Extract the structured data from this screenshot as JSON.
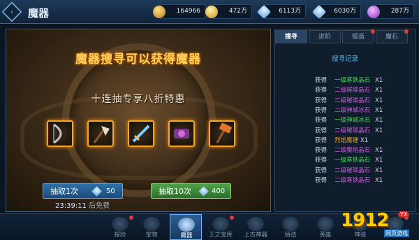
{
  "header": {
    "back_icon_label": "‹",
    "title": "魔器"
  },
  "resources": [
    {
      "icon": "coin-icon",
      "value": "164966"
    },
    {
      "icon": "gold-icon",
      "value": "472万"
    },
    {
      "icon": "crystal-icon",
      "value": "6113万"
    },
    {
      "icon": "crystal-icon",
      "value": "6030万"
    },
    {
      "icon": "gem-icon",
      "value": "287万"
    }
  ],
  "main": {
    "headline": "魔器搜寻可以获得魔器",
    "subline": "十连抽专享八折特惠",
    "draw_one": {
      "label": "抽取1次",
      "cost": "50"
    },
    "draw_ten": {
      "label": "抽取10次",
      "cost": "400"
    },
    "timer": "23:39:11",
    "timer_suffix": "后免费"
  },
  "tabs": [
    {
      "label": "搜寻",
      "active": true
    },
    {
      "label": "进阶",
      "active": false
    },
    {
      "label": "锻造",
      "active": false
    },
    {
      "label": "魔石",
      "active": false
    }
  ],
  "records": {
    "title": "搜寻记录",
    "items": [
      {
        "verb": "获得",
        "name": "一级寒铁晶石",
        "qty": "X1",
        "color": "green"
      },
      {
        "verb": "获得",
        "name": "二级璀璨晶石",
        "qty": "X1",
        "color": "purple"
      },
      {
        "verb": "获得",
        "name": "二级璀璨晶石",
        "qty": "X1",
        "color": "purple"
      },
      {
        "verb": "获得",
        "name": "二级神城冰石",
        "qty": "X1",
        "color": "purple"
      },
      {
        "verb": "获得",
        "name": "一级神城冰石",
        "qty": "X1",
        "color": "green"
      },
      {
        "verb": "获得",
        "name": "二级璀璨晶石",
        "qty": "X1",
        "color": "purple"
      },
      {
        "verb": "获得",
        "name": "烈焰魔锤",
        "qty": "X1",
        "color": "orange"
      },
      {
        "verb": "获得",
        "name": "二级魔焰晶石",
        "qty": "X1",
        "color": "purple"
      },
      {
        "verb": "获得",
        "name": "一级寒铁晶石",
        "qty": "X1",
        "color": "green"
      },
      {
        "verb": "获得",
        "name": "二级璀璨晶石",
        "qty": "X1",
        "color": "purple"
      },
      {
        "verb": "获得",
        "name": "二级寒铁晶石",
        "qty": "X1",
        "color": "purple"
      }
    ]
  },
  "nav": [
    {
      "label": "探险",
      "icon": "explore-icon",
      "dot": true
    },
    {
      "label": "宝物",
      "icon": "treasure-icon",
      "dot": false
    },
    {
      "label": "魔器",
      "icon": "magic-weapon-icon",
      "dot": false,
      "active": true
    },
    {
      "label": "王之宝库",
      "icon": "vault-icon",
      "dot": true
    },
    {
      "label": "上古神器",
      "icon": "artifact-icon",
      "dot": false
    },
    {
      "label": "铸造",
      "icon": "forge-icon",
      "dot": false
    },
    {
      "label": "英雄",
      "icon": "hero-icon",
      "dot": false
    },
    {
      "label": "神装",
      "icon": "divine-gear-icon",
      "dot": false
    },
    {
      "label": "神装",
      "icon": "divine-gear-icon",
      "dot": true
    }
  ],
  "logo": {
    "number": "1912",
    "badge": "YX",
    "tagline": "网页游戏"
  }
}
